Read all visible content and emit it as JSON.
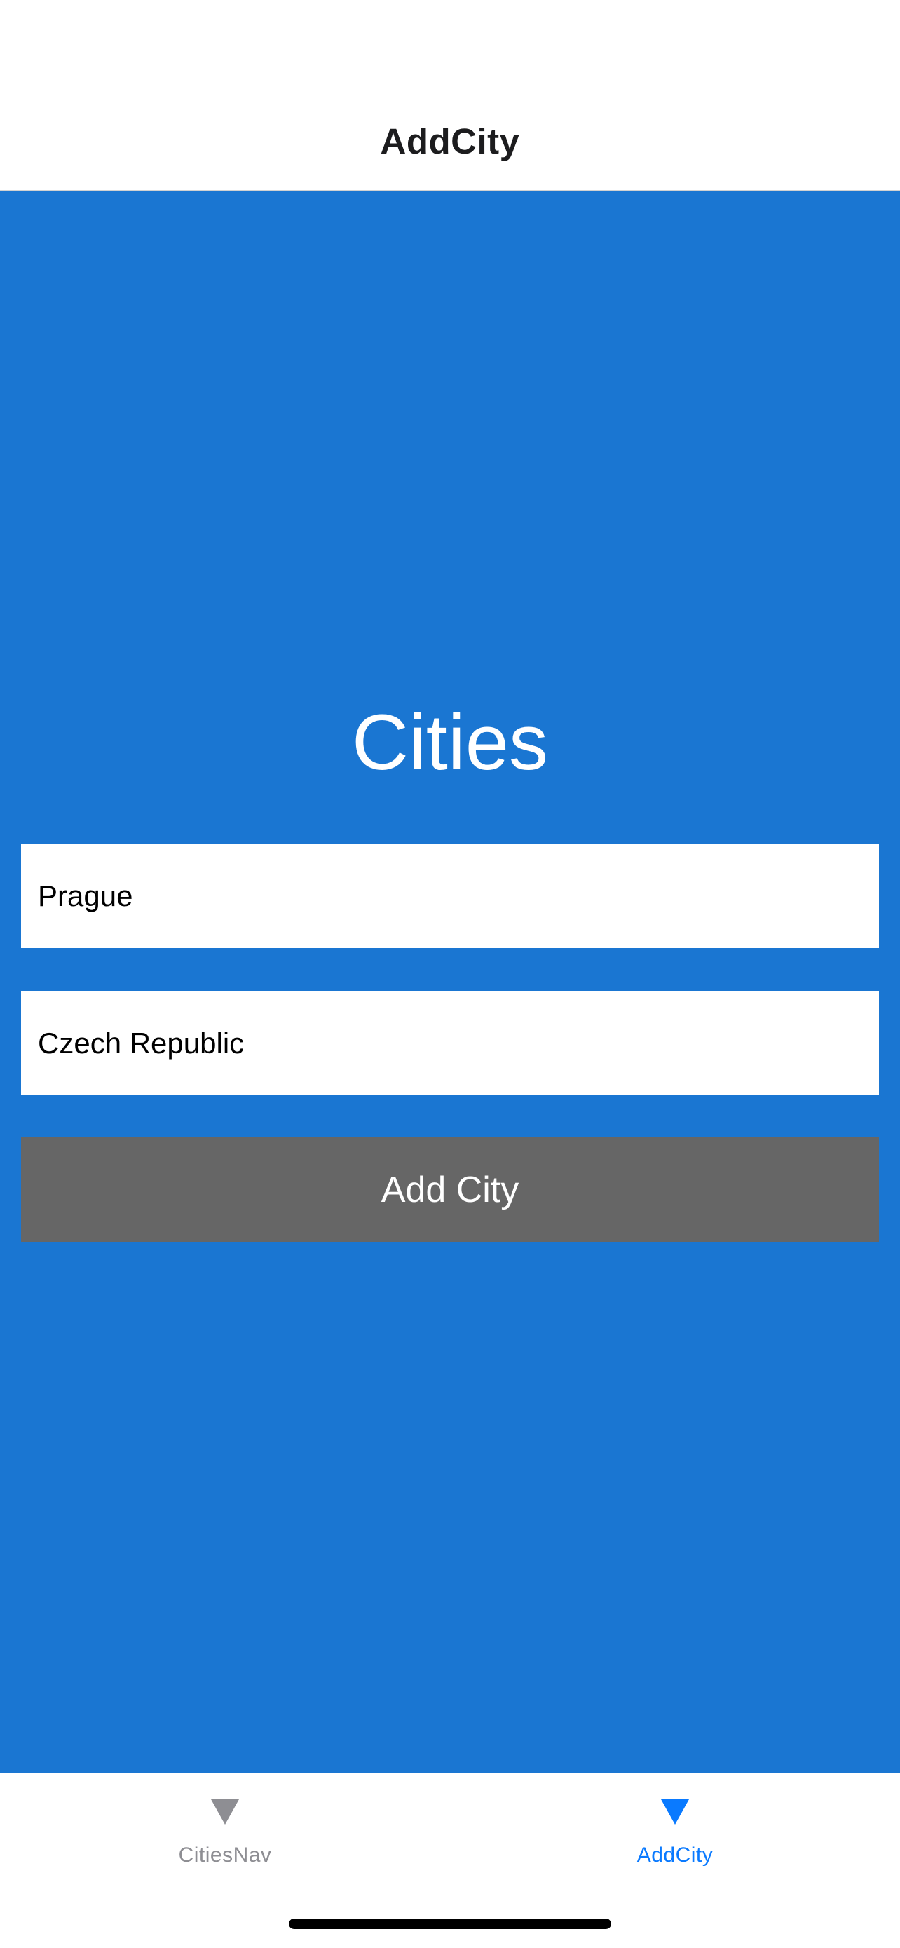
{
  "header": {
    "title": "AddCity"
  },
  "main": {
    "heading": "Cities",
    "city_input": {
      "value": "Prague"
    },
    "country_input": {
      "value": "Czech Republic"
    },
    "add_button_label": "Add City"
  },
  "tab_bar": {
    "tabs": [
      {
        "label": "CitiesNav",
        "icon": "triangle-down-icon",
        "active": false
      },
      {
        "label": "AddCity",
        "icon": "triangle-down-icon",
        "active": true
      }
    ]
  },
  "colors": {
    "content_background": "#1a76d2",
    "button_background": "#666666",
    "active_tab": "#0a7aff",
    "inactive_tab": "#8e8e93"
  }
}
